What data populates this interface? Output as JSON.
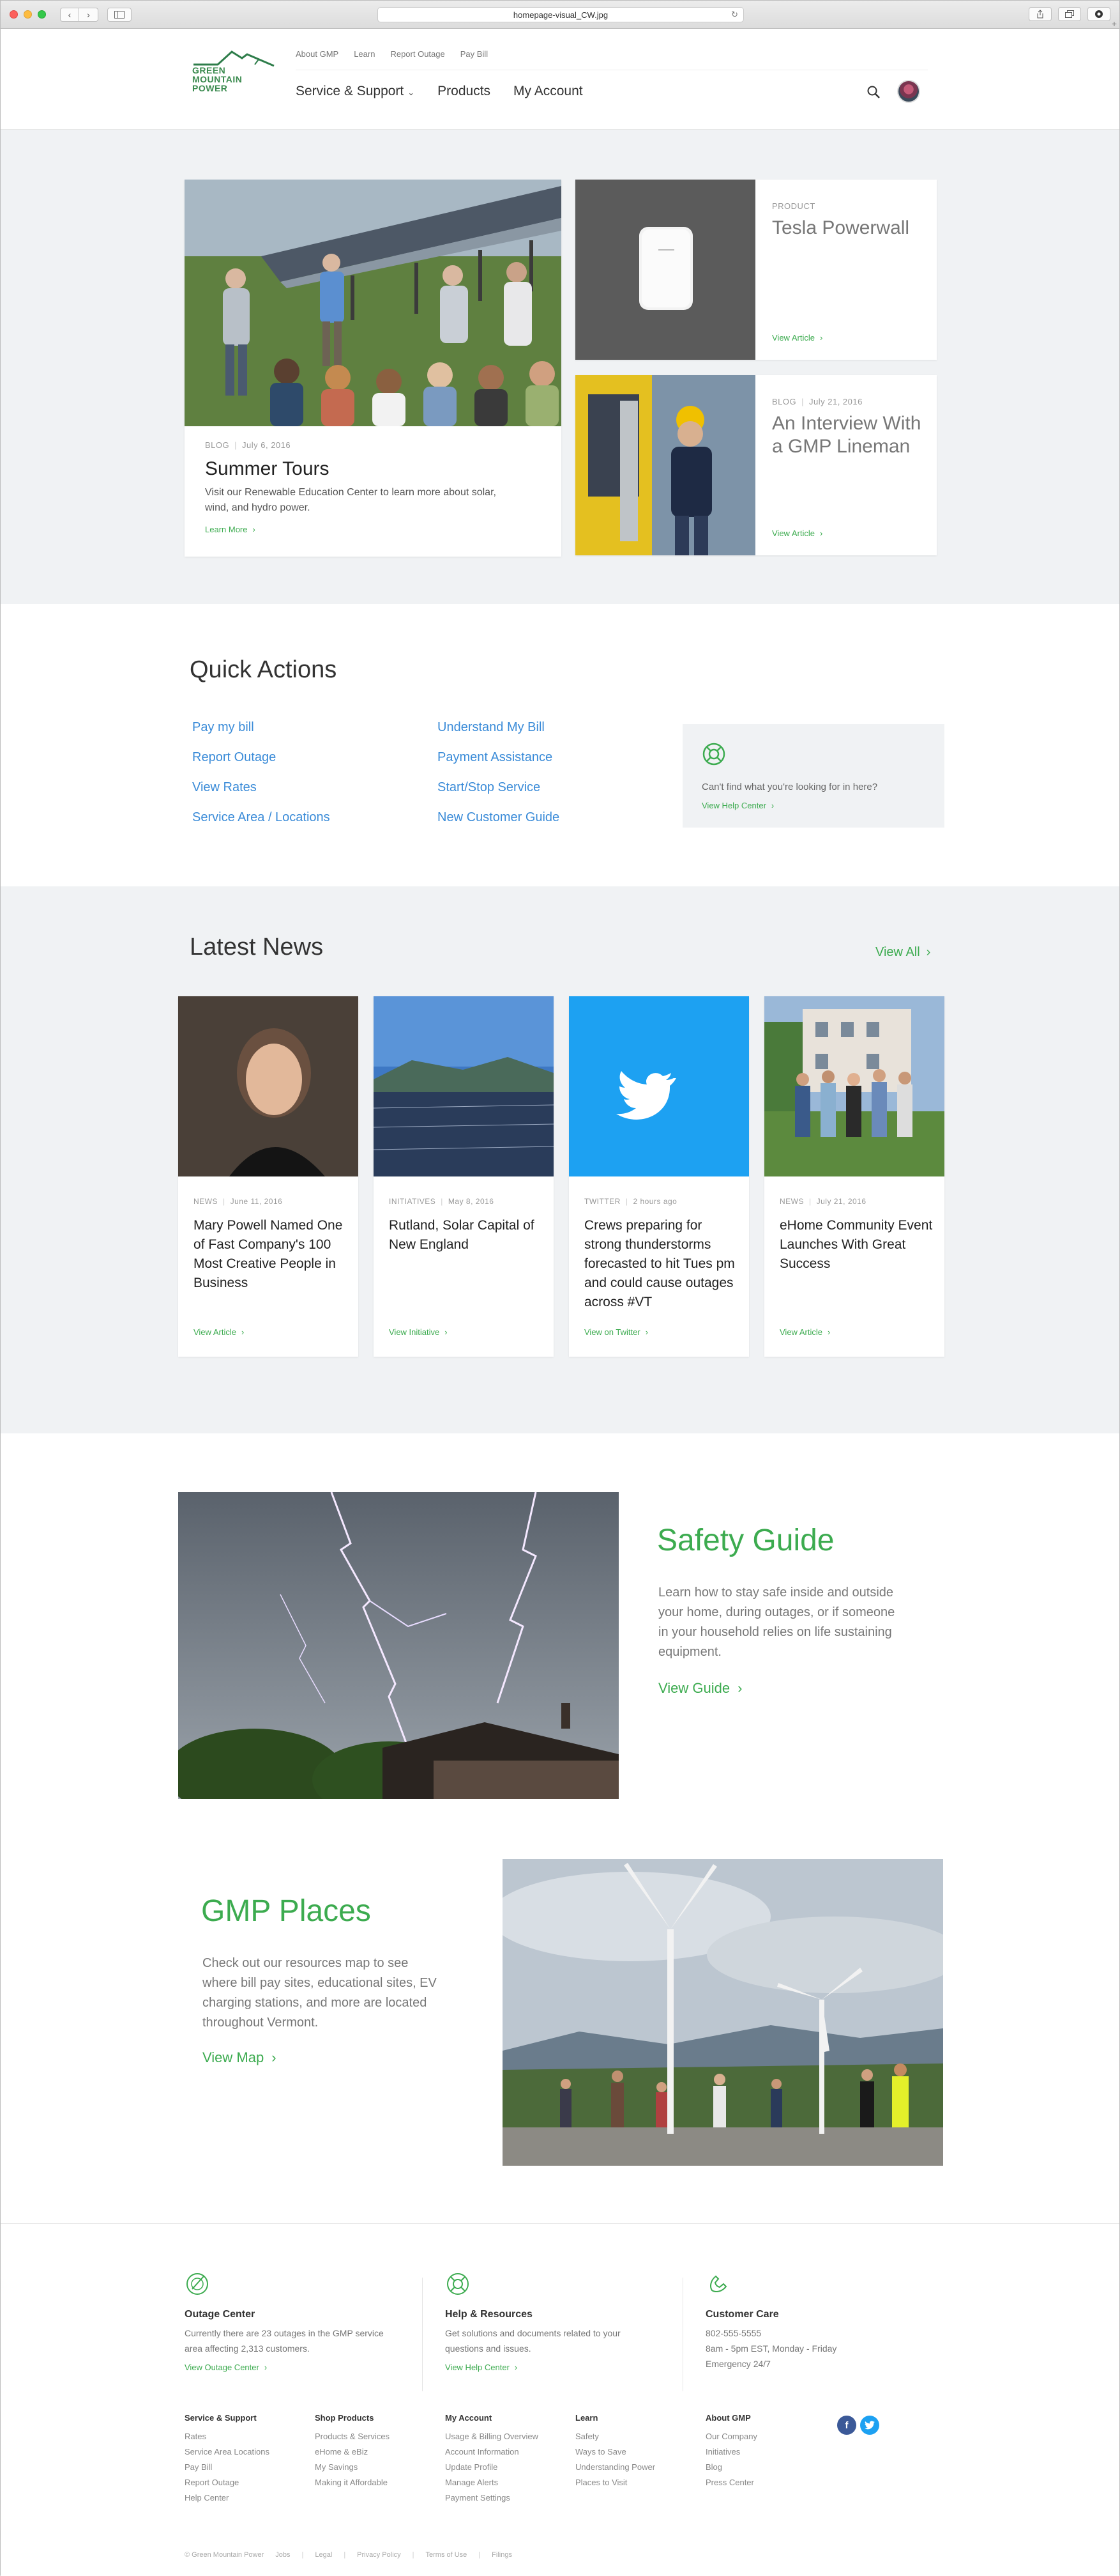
{
  "browser": {
    "url": "homepage-visual_CW.jpg"
  },
  "header": {
    "logo_lines": [
      "GREEN",
      "MOUNTAIN",
      "POWER"
    ],
    "utility": [
      "About GMP",
      "Learn",
      "Report Outage",
      "Pay Bill"
    ],
    "nav": [
      {
        "label": "Service & Support",
        "has_dropdown": true
      },
      {
        "label": "Products"
      },
      {
        "label": "My Account"
      }
    ]
  },
  "hero": {
    "main": {
      "category": "BLOG",
      "date": "July 6, 2016",
      "title": "Summer Tours",
      "description": "Visit our Renewable Education Center to learn more about solar, wind, and hydro power.",
      "link": "Learn More"
    },
    "side": [
      {
        "category": "PRODUCT",
        "date": "",
        "title": "Tesla Powerwall",
        "link": "View Article"
      },
      {
        "category": "BLOG",
        "date": "July 21, 2016",
        "title": "An Interview With a GMP Lineman",
        "link": "View Article"
      }
    ]
  },
  "quick_actions": {
    "title": "Quick Actions",
    "col1": [
      "Pay my bill",
      "Report Outage",
      "View Rates",
      "Service Area / Locations"
    ],
    "col2": [
      "Understand My Bill",
      "Payment Assistance",
      "Start/Stop Service",
      "New Customer Guide"
    ],
    "help": {
      "text": "Can't find what you're looking for in here?",
      "link": "View Help Center"
    }
  },
  "news": {
    "title": "Latest News",
    "view_all": "View All",
    "items": [
      {
        "category": "NEWS",
        "date": "June 11, 2016",
        "title": "Mary Powell Named One of Fast Company's 100 Most Creative People in Business",
        "link": "View Article"
      },
      {
        "category": "INITIATIVES",
        "date": "May 8, 2016",
        "title": "Rutland, Solar Capital of New England",
        "link": "View Initiative"
      },
      {
        "category": "TWITTER",
        "date": "2 hours ago",
        "title": "Crews preparing for strong thunderstorms forecasted to hit Tues pm and could cause outages across #VT",
        "link": "View on Twitter"
      },
      {
        "category": "NEWS",
        "date": "July 21, 2016",
        "title": "eHome Community Event Launches With Great Success",
        "link": "View Article"
      }
    ]
  },
  "safety": {
    "title": "Safety Guide",
    "description": "Learn how to stay safe inside and outside your home, during outages, or if someone in your household relies on life sustaining equipment.",
    "link": "View Guide"
  },
  "places": {
    "title": "GMP Places",
    "description": "Check out our resources map to see where bill pay sites, educational sites, EV charging stations, and more are located throughout Vermont.",
    "link": "View Map"
  },
  "footer": {
    "cols": [
      {
        "title": "Outage Center",
        "text": "Currently there are 23 outages in the GMP service area affecting 2,313 customers.",
        "link": "View Outage Center"
      },
      {
        "title": "Help & Resources",
        "text": "Get solutions and documents related to your questions and issues.",
        "link": "View Help Center"
      },
      {
        "title": "Customer Care",
        "lines": [
          "802-555-5555",
          "8am - 5pm EST, Monday - Friday",
          "Emergency 24/7"
        ]
      }
    ],
    "link_groups": [
      {
        "title": "Service & Support",
        "items": [
          "Rates",
          "Service Area Locations",
          "Pay Bill",
          "Report Outage",
          "Help Center"
        ]
      },
      {
        "title": "Shop Products",
        "items": [
          "Products & Services",
          "eHome & eBiz",
          "My Savings",
          "Making it Affordable"
        ]
      },
      {
        "title": "My Account",
        "items": [
          "Usage & Billing Overview",
          "Account Information",
          "Update Profile",
          "Manage Alerts",
          "Payment Settings"
        ]
      },
      {
        "title": "Learn",
        "items": [
          "Safety",
          "Ways to Save",
          "Understanding Power",
          "Places to Visit"
        ]
      },
      {
        "title": "About GMP",
        "items": [
          "Our Company",
          "Initiatives",
          "Blog",
          "Press Center"
        ]
      }
    ],
    "legal": [
      "© Green Mountain Power",
      "Jobs",
      "Legal",
      "Privacy Policy",
      "Terms of Use",
      "Filings"
    ]
  }
}
